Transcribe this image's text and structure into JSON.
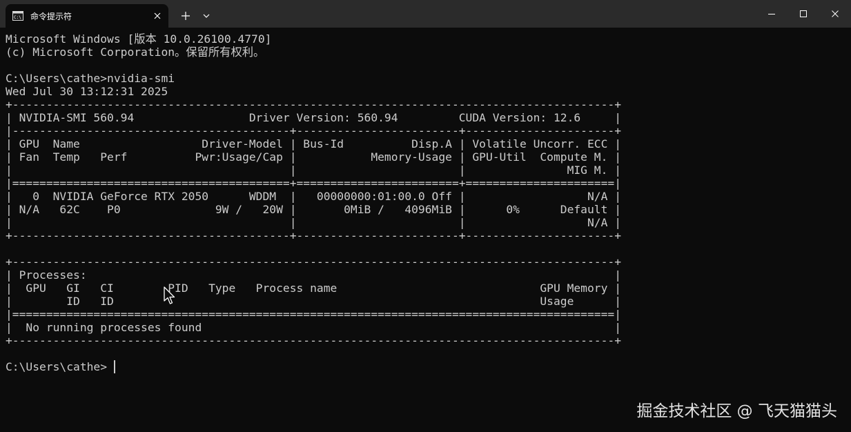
{
  "window": {
    "tab_title": "命令提示符",
    "tab_icon": "terminal-icon",
    "controls": [
      "minimize-icon",
      "maximize-icon",
      "close-icon"
    ]
  },
  "terminal": {
    "lines": [
      "Microsoft Windows [版本 10.0.26100.4770]",
      "(c) Microsoft Corporation。保留所有权利。",
      "",
      "C:\\Users\\cathe>nvidia-smi",
      "Wed Jul 30 13:12:31 2025",
      "+-----------------------------------------------------------------------------------------+",
      "| NVIDIA-SMI 560.94                 Driver Version: 560.94         CUDA Version: 12.6     |",
      "|-----------------------------------------+------------------------+----------------------+",
      "| GPU  Name                  Driver-Model | Bus-Id          Disp.A | Volatile Uncorr. ECC |",
      "| Fan  Temp   Perf          Pwr:Usage/Cap |           Memory-Usage | GPU-Util  Compute M. |",
      "|                                         |                        |               MIG M. |",
      "|=========================================+========================+======================|",
      "|   0  NVIDIA GeForce RTX 2050      WDDM  |   00000000:01:00.0 Off |                  N/A |",
      "| N/A   62C    P0              9W /   20W |       0MiB /   4096MiB |      0%      Default |",
      "|                                         |                        |                  N/A |",
      "+-----------------------------------------+------------------------+----------------------+",
      "",
      "+-----------------------------------------------------------------------------------------+",
      "| Processes:                                                                              |",
      "|  GPU   GI   CI        PID   Type   Process name                              GPU Memory |",
      "|        ID   ID                                                               Usage      |",
      "|=========================================================================================|",
      "|  No running processes found                                                             |",
      "+-----------------------------------------------------------------------------------------+",
      "",
      "C:\\Users\\cathe>"
    ]
  },
  "watermark": "掘金技术社区 @ 飞天猫猫头"
}
